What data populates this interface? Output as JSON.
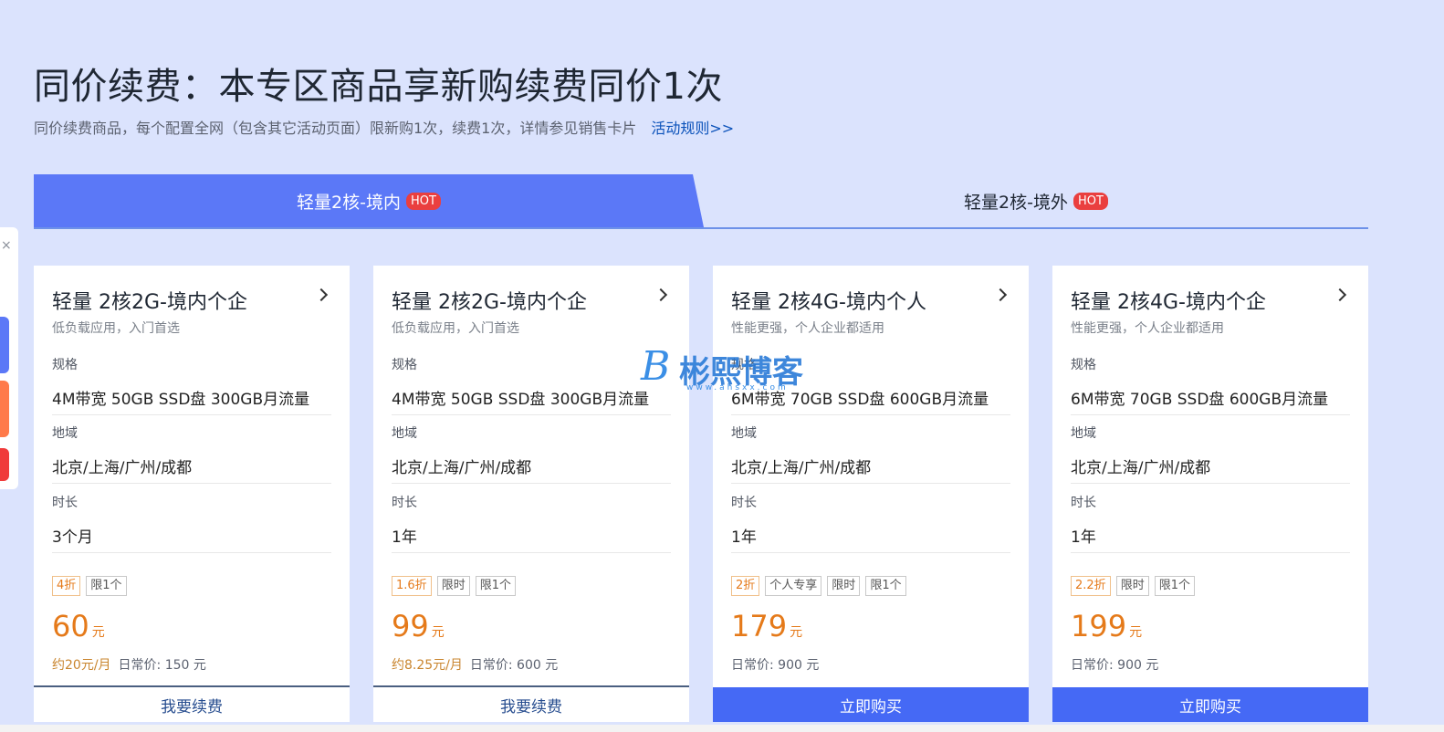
{
  "header": {
    "title": "同价续费：本专区商品享新购续费同价1次",
    "subtitle": "同价续费商品，每个配置全网（包含其它活动页面）限新购1次，续费1次，详情参见销售卡片",
    "rules_link": "活动规则>>"
  },
  "tabs": [
    {
      "label": "轻量2核-境内",
      "badge": "HOT"
    },
    {
      "label": "轻量2核-境外",
      "badge": "HOT"
    }
  ],
  "side_widget": {
    "close": "×"
  },
  "labels": {
    "spec": "规格",
    "region": "地域",
    "duration": "时长"
  },
  "cards": [
    {
      "title": "轻量 2核2G-境内个企",
      "desc": "低负载应用，入门首选",
      "spec": "4M带宽 50GB SSD盘 300GB月流量",
      "region": "北京/上海/广州/成都",
      "duration": "3个月",
      "tags": [
        "4折",
        "限1个"
      ],
      "price": "60",
      "unit": "元",
      "monthly": "约20元/月",
      "regular": "日常价: 150 元",
      "button": "我要续费"
    },
    {
      "title": "轻量 2核2G-境内个企",
      "desc": "低负载应用，入门首选",
      "spec": "4M带宽 50GB SSD盘 300GB月流量",
      "region": "北京/上海/广州/成都",
      "duration": "1年",
      "tags": [
        "1.6折",
        "限时",
        "限1个"
      ],
      "price": "99",
      "unit": "元",
      "monthly": "约8.25元/月",
      "regular": "日常价: 600 元",
      "button": "我要续费"
    },
    {
      "title": "轻量 2核4G-境内个人",
      "desc": "性能更强，个人企业都适用",
      "spec": "6M带宽 70GB SSD盘 600GB月流量",
      "region": "北京/上海/广州/成都",
      "duration": "1年",
      "tags": [
        "2折",
        "个人专享",
        "限时",
        "限1个"
      ],
      "price": "179",
      "unit": "元",
      "monthly": "",
      "regular": "日常价: 900 元",
      "button": "立即购买"
    },
    {
      "title": "轻量 2核4G-境内个企",
      "desc": "性能更强，个人企业都适用",
      "spec": "6M带宽 70GB SSD盘 600GB月流量",
      "region": "北京/上海/广州/成都",
      "duration": "1年",
      "tags": [
        "2.2折",
        "限时",
        "限1个"
      ],
      "price": "199",
      "unit": "元",
      "monthly": "",
      "regular": "日常价: 900 元",
      "button": "立即购买"
    }
  ],
  "watermark": {
    "letter": "B",
    "text": "彬熙博客",
    "url": "www.ahsxx.com"
  },
  "colors": {
    "accent": "#4569f5",
    "price": "#e57a1a",
    "background": "#dbe3fd"
  }
}
